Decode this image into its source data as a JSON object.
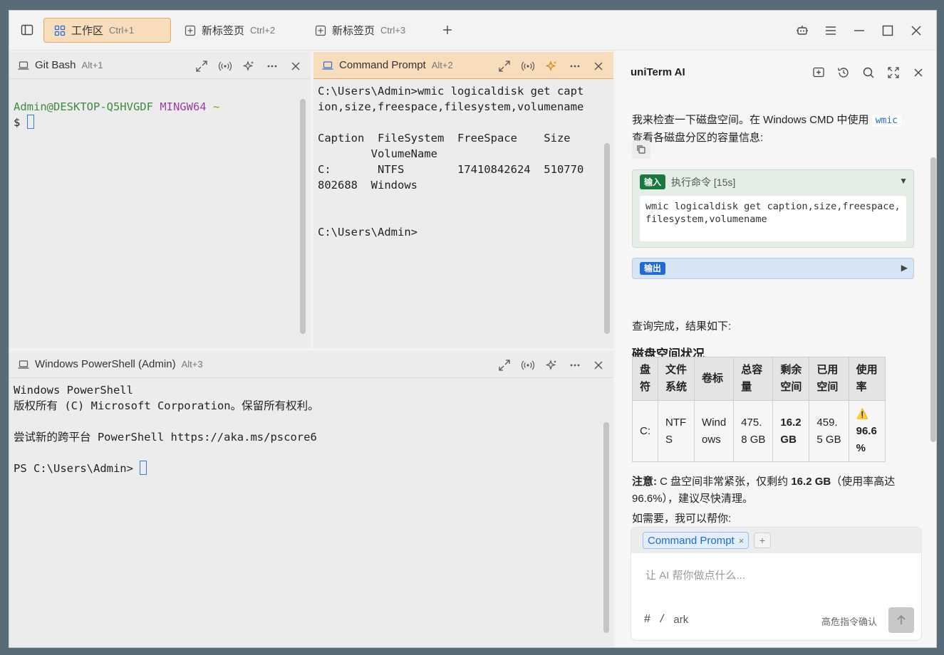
{
  "tabs": [
    {
      "label": "工作区",
      "shortcut": "Ctrl+1"
    },
    {
      "label": "新标签页",
      "shortcut": "Ctrl+2"
    },
    {
      "label": "新标签页",
      "shortcut": "Ctrl+3"
    }
  ],
  "panes": {
    "gitbash": {
      "title": "Git Bash",
      "shortcut": "Alt+1",
      "prompt_user": "Admin@DESKTOP-Q5HVGDF",
      "prompt_env": "MINGW64",
      "prompt_path": "~",
      "prompt_symbol": "$"
    },
    "cmd": {
      "title": "Command Prompt",
      "shortcut": "Alt+2",
      "lines": [
        "C:\\Users\\Admin>wmic logicaldisk get capt",
        "ion,size,freespace,filesystem,volumename",
        "",
        "Caption  FileSystem  FreeSpace    Size",
        "        VolumeName",
        "C:       NTFS        17410842624  510770",
        "802688  Windows",
        "",
        "",
        "C:\\Users\\Admin>"
      ]
    },
    "powershell": {
      "title": "Windows PowerShell (Admin)",
      "shortcut": "Alt+3",
      "lines": [
        "Windows PowerShell",
        "版权所有 (C) Microsoft Corporation。保留所有权利。",
        "",
        "尝试新的跨平台 PowerShell https://aka.ms/pscore6",
        ""
      ],
      "prompt": "PS C:\\Users\\Admin> "
    }
  },
  "ai": {
    "title": "uniTerm AI",
    "intro_part1": "我来检查一下磁盘空间。在 Windows CMD 中使用",
    "intro_code": "wmic",
    "intro_part2": "查看各磁盘分区的容量信息:",
    "input_badge": "输入",
    "input_label": "执行命令 [15s]",
    "input_command": "wmic logicaldisk get caption,size,freespace,filesystem,volumename",
    "output_badge": "输出",
    "result_text": "查询完成，结果如下:",
    "section_title": "磁盘空间状况",
    "table": {
      "headers": [
        "盘\n符",
        "文件\n系统",
        "卷标",
        "总容\n量",
        "剩余\n空间",
        "已用\n空间",
        "使用\n率"
      ],
      "row": {
        "drive": "C:",
        "fs": "NTF\nS",
        "label": "Wind\nows",
        "total": "475.\n8 GB",
        "free": "16.2\nGB",
        "used": "459.\n5 GB",
        "usage_icon": "⚠️",
        "usage": "96.6\n%"
      }
    },
    "note_label": "注意:",
    "note_text1": " C 盘空间非常紧张，仅剩约 ",
    "note_bold": "16.2 GB",
    "note_text2": "（使用率高达 96.6%），建议尽快清理。",
    "help_text": "如需要，我可以帮你:",
    "chip_label": "Command Prompt",
    "chip_close": "×",
    "chip_add": "+",
    "placeholder": "让 AI 帮你做点什么...",
    "tool_hash": "#",
    "tool_slash": "/",
    "model": "ark",
    "confirm_label": "高危指令确认"
  }
}
